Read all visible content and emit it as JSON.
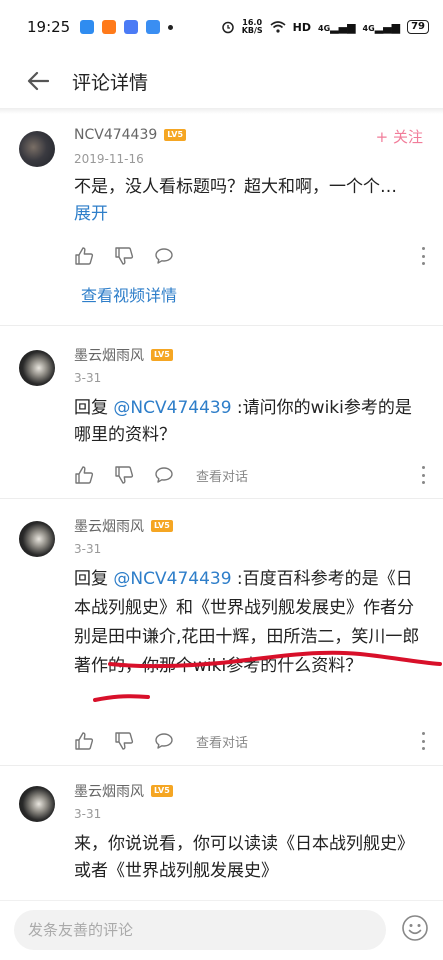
{
  "status_bar": {
    "time": "19:25",
    "net_speed_value": "16.0",
    "net_speed_unit": "KB/S",
    "hd_label": "HD",
    "signal1_label": "4G",
    "signal2_label": "4G",
    "battery": "79"
  },
  "header": {
    "title": "评论详情"
  },
  "main_comment": {
    "username": "NCV474439",
    "level": "LV5",
    "date": "2019-11-16",
    "follow_label": "+ 关注",
    "text": "不是，没人看标题吗？超大和啊，一个个…",
    "expand_label": "展开",
    "video_link": "查看视频详情"
  },
  "replies": [
    {
      "username": "墨云烟雨风",
      "level": "LV5",
      "date": "3-31",
      "prefix": "回复 ",
      "mention": "@NCV474439",
      "text": " :请问你的wiki参考的是哪里的资料？",
      "view_conversation": "查看对话"
    },
    {
      "username": "墨云烟雨风",
      "level": "LV5",
      "date": "3-31",
      "prefix": "回复 ",
      "mention": "@NCV474439",
      "text": " :百度百科参考的是《日本战列舰史》和《世界战列舰发展史》作者分别是田中谦介,花田十辉，田所浩二，笑川一郎著作的，你那个wiki参考的什么资料？",
      "view_conversation": "查看对话"
    },
    {
      "username": "墨云烟雨风",
      "level": "LV5",
      "date": "3-31",
      "text": "来，你说说看，你可以读读《日本战列舰史》或者《世界战列舰发展史》"
    }
  ],
  "bottom_bar": {
    "placeholder": "发条友善的评论"
  },
  "colors": {
    "accent_blue": "#2e7ec9",
    "follow_pink": "#f17c99",
    "level_badge": "#f5a623",
    "underline_red": "#d8102a"
  }
}
